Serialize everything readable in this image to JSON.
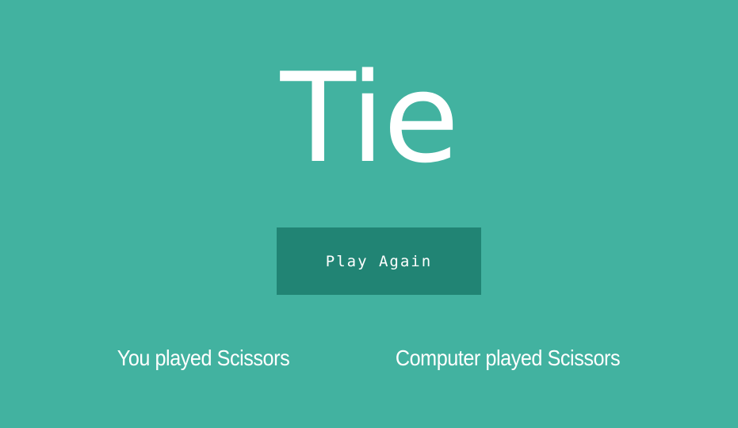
{
  "game": {
    "result_title": "Tie",
    "play_again_label": "Play Again",
    "player_move_text": "You played Scissors",
    "computer_move_text": "Computer played Scissors"
  },
  "colors": {
    "background": "#42b2a0",
    "button_background": "#218474",
    "text": "#ffffff"
  }
}
